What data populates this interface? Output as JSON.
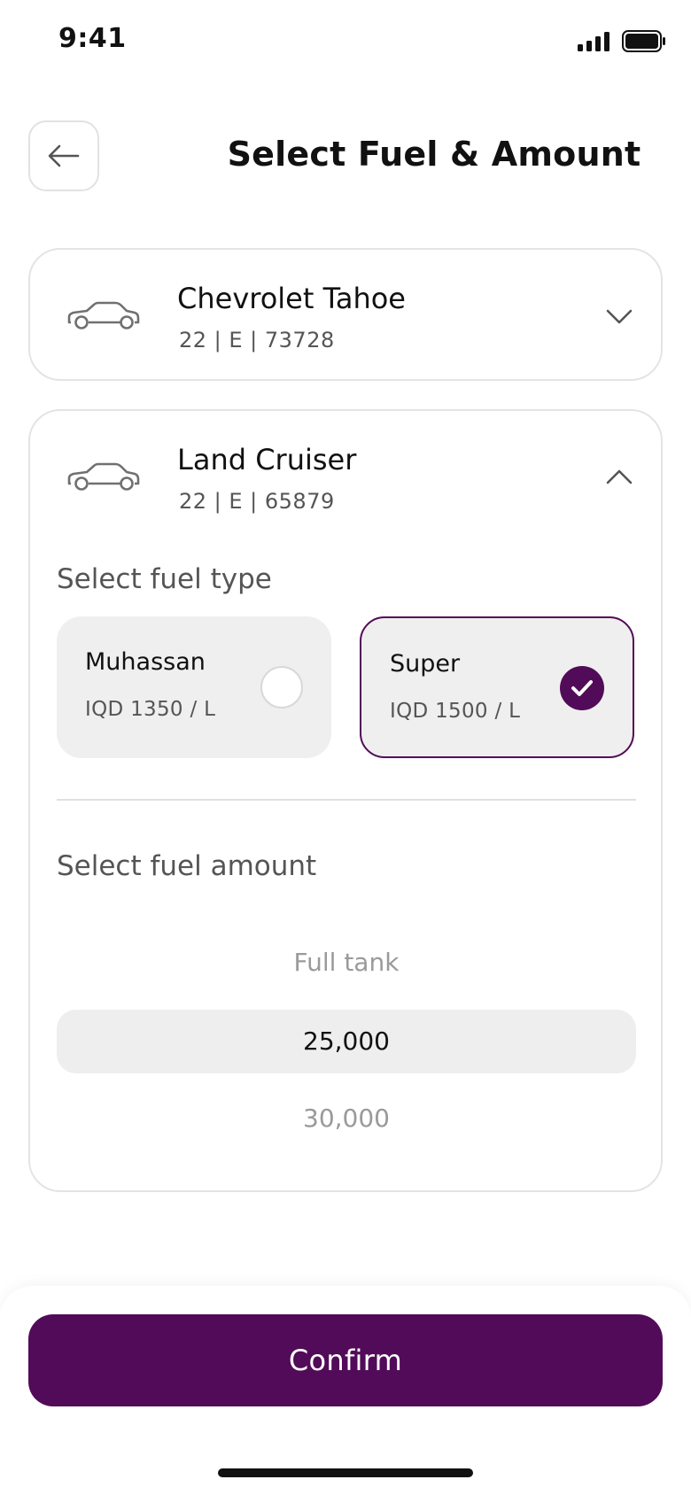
{
  "status_bar": {
    "time": "9:41",
    "icons": [
      "signal-icon",
      "battery-icon"
    ]
  },
  "header": {
    "back_icon": "arrow-left-icon",
    "title": "Select Fuel & Amount"
  },
  "vehicles": [
    {
      "name": "Chevrolet Tahoe",
      "plate": "22 | E | 73728",
      "icon": "car-icon",
      "expanded": false,
      "chevron": "chevron-down-icon"
    },
    {
      "name": "Land Cruiser",
      "plate": "22 | E | 65879",
      "icon": "car-icon",
      "expanded": true,
      "chevron": "chevron-up-icon",
      "fuel_type_label": "Select fuel type",
      "fuel_options": [
        {
          "name": "Muhassan",
          "price": "IQD 1350 / L",
          "selected": false
        },
        {
          "name": "Super",
          "price": "IQD 1500 / L",
          "selected": true
        }
      ],
      "fuel_amount_label": "Select fuel amount",
      "amount_options": [
        "Full tank",
        "25,000",
        "30,000"
      ],
      "selected_amount": "25,000"
    }
  ],
  "confirm_label": "Confirm",
  "colors": {
    "accent": "#520b58",
    "card_border": "#e4e4e4",
    "option_bg": "#efefef",
    "muted_text": "#9a9a9a"
  }
}
